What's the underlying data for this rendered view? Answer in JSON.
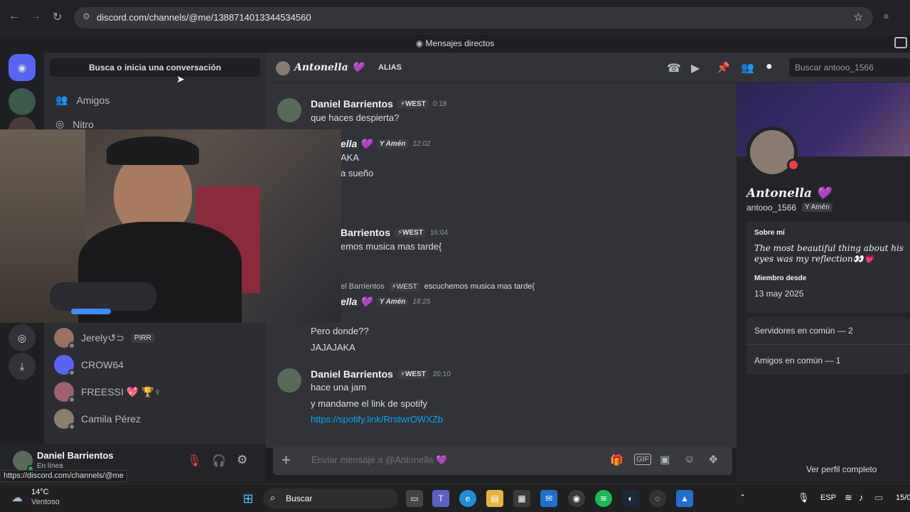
{
  "browser": {
    "url": "discord.com/channels/@me/1388714013344534560",
    "back": "←",
    "forward": "→",
    "reload": "↻",
    "star": "☆",
    "status_url": "https://discord.com/channels/@me"
  },
  "app_title": "Mensajes directos",
  "sidebar": {
    "search_label": "Busca o inicia una conversación",
    "nav": [
      {
        "label": "Amigos",
        "icon": "friends-icon"
      },
      {
        "label": "Nitro",
        "icon": "nitro-icon"
      }
    ],
    "dms": [
      {
        "name": "Jerely↺⊃",
        "tag": "PIRR"
      },
      {
        "name": "CROW64",
        "tag": ""
      },
      {
        "name": "FREESSI 💖 🏆♀",
        "tag": ""
      },
      {
        "name": "Camila Pérez",
        "tag": ""
      }
    ]
  },
  "user_panel": {
    "name": "Daniel Barrientos",
    "status": "En línea"
  },
  "chat_header": {
    "name": "Antonella 💜",
    "alias_label": "ALIAS",
    "search_placeholder": "Buscar antooo_1566"
  },
  "messages": [
    {
      "author": "Daniel Barrientos",
      "tag": "⚡WEST",
      "time": "0:18",
      "lines": [
        "que haces despierta?"
      ]
    },
    {
      "author": "ella 💜",
      "tag": "Y Amén",
      "time": "12:02",
      "lines": [
        "AKA",
        "a sueño"
      ]
    },
    {
      "author": "Barrientos",
      "tag": "⚡WEST",
      "time": "16:04",
      "lines": [
        "emos musica mas tarde{"
      ]
    },
    {
      "reply_author": "el Barrientos",
      "reply_tag": "⚡WEST",
      "reply_text": "escuchemos musica mas tarde{",
      "author": "ella 💜",
      "tag": "Y Amén",
      "time": "18:25",
      "lines": [
        "Pero donde??",
        "JAJAJAKA"
      ]
    },
    {
      "author": "Daniel Barrientos",
      "tag": "⚡WEST",
      "time": "20:10",
      "lines": [
        "hace una jam",
        "y mandame el link de  spotify"
      ],
      "link": "https://spotify.link/RrstwrOWXZb"
    }
  ],
  "composer": {
    "placeholder": "Enviar mensaje a @Antonella 💜",
    "plus": "+"
  },
  "profile": {
    "display_name": "Antonella 💜",
    "username": "antooo_1566",
    "tag": "Y Amén",
    "about_title": "Sobre mí",
    "about_text": "The most beautiful thing about his eyes was my reflection👀💗",
    "member_since_title": "Miembro desde",
    "member_since": "13 may 2025",
    "servers_common": "Servidores en común — 2",
    "friends_common": "Amigos en común — 1",
    "view_full": "Ver perfil completo"
  },
  "taskbar": {
    "weather_temp": "14°C",
    "weather_desc": "Ventoso",
    "search": "Buscar",
    "lang": "ESP",
    "date": "15/0"
  },
  "colors": {
    "accent": "#5865f2",
    "link": "#00a8fc",
    "bg_dark": "#1e1f22",
    "bg_chat": "#313338"
  }
}
